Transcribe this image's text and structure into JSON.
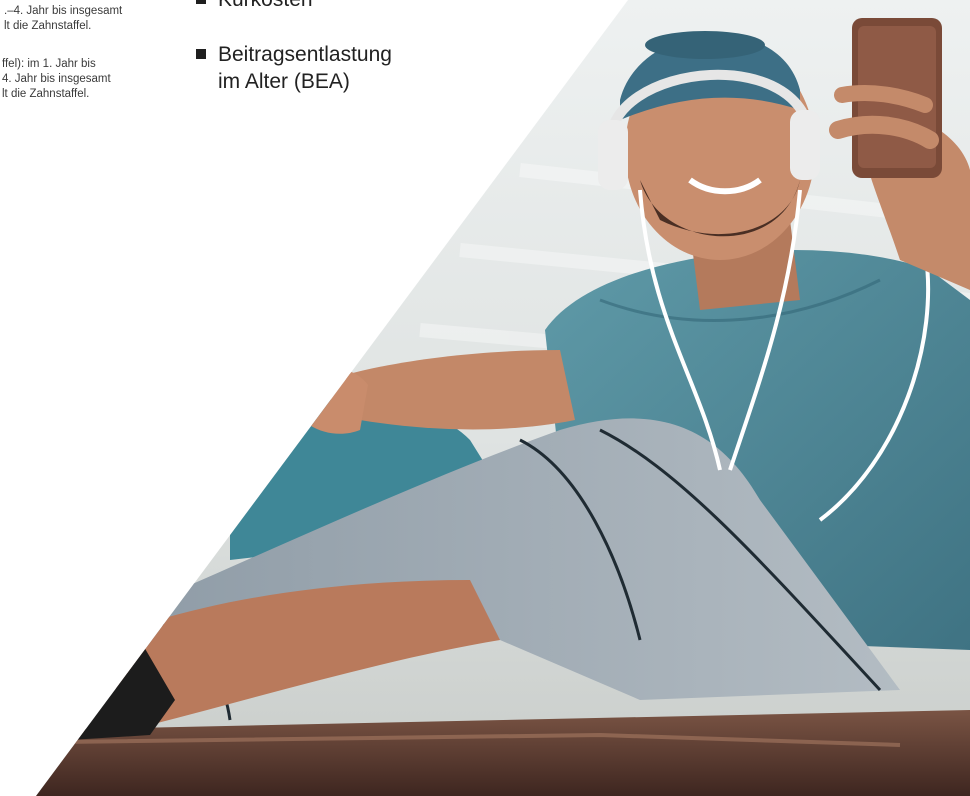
{
  "fragment": {
    "lines": [
      ".–4. Jahr bis insgesamt",
      "lt die Zahnstaffel.",
      "ffel): im 1. Jahr bis",
      " 4. Jahr bis insgesamt",
      "lt die Zahnstaffel."
    ]
  },
  "bullets": [
    {
      "label": "Kurkosten"
    },
    {
      "label_line1": "Beitragsentlastung",
      "label_line2": "im Alter (BEA)"
    }
  ],
  "photo": {
    "subject": "smiling-athlete-with-headphones-and-phone",
    "colors": {
      "shirt": "#4f8a9a",
      "leggings": "#9aa6b0",
      "skin": "#c88a6a",
      "cap": "#3d6f86",
      "ground": "#5a3a30"
    }
  }
}
